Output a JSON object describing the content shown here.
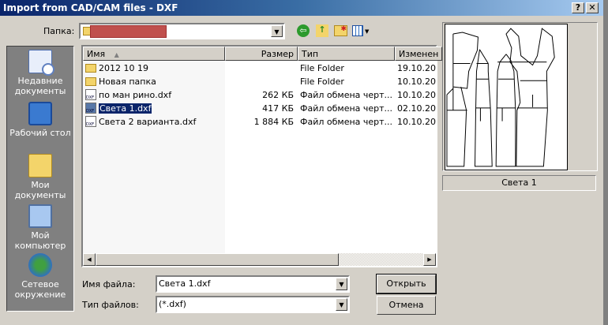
{
  "window": {
    "title": "Import from CAD/CAM files - DXF",
    "help": "?",
    "close": "✕"
  },
  "lookin": {
    "label": "Папка:",
    "value": ""
  },
  "places": [
    {
      "label": "Недавние документы",
      "icon": "recent-documents-icon"
    },
    {
      "label": "Рабочий стол",
      "icon": "desktop-icon"
    },
    {
      "label": "Мои документы",
      "icon": "my-documents-icon"
    },
    {
      "label": "Мой компьютер",
      "icon": "my-computer-icon"
    },
    {
      "label": "Сетевое окружение",
      "icon": "network-icon"
    }
  ],
  "columns": [
    "Имя",
    "Размер",
    "Тип",
    "Изменен"
  ],
  "files": [
    {
      "name": "2012 10 19",
      "size": "",
      "type": "File Folder",
      "modified": "19.10.20",
      "kind": "folder"
    },
    {
      "name": "Новая папка",
      "size": "",
      "type": "File Folder",
      "modified": "10.10.20",
      "kind": "folder"
    },
    {
      "name": "по ман рино.dxf",
      "size": "262 КБ",
      "type": "Файл обмена черт...",
      "modified": "10.10.20",
      "kind": "dxf"
    },
    {
      "name": "Света 1.dxf",
      "size": "417 КБ",
      "type": "Файл обмена черт...",
      "modified": "02.10.20",
      "kind": "dxf",
      "selected": true
    },
    {
      "name": "Света 2 варианта.dxf",
      "size": "1 884 КБ",
      "type": "Файл обмена черт...",
      "modified": "10.10.20",
      "kind": "dxf"
    }
  ],
  "filename": {
    "label": "Имя файла:",
    "value": "Света 1.dxf"
  },
  "filetype": {
    "label": "Тип файлов:",
    "value": "(*.dxf)"
  },
  "buttons": {
    "open": "Открыть",
    "cancel": "Отмена"
  },
  "preview": {
    "caption": "Света 1"
  }
}
